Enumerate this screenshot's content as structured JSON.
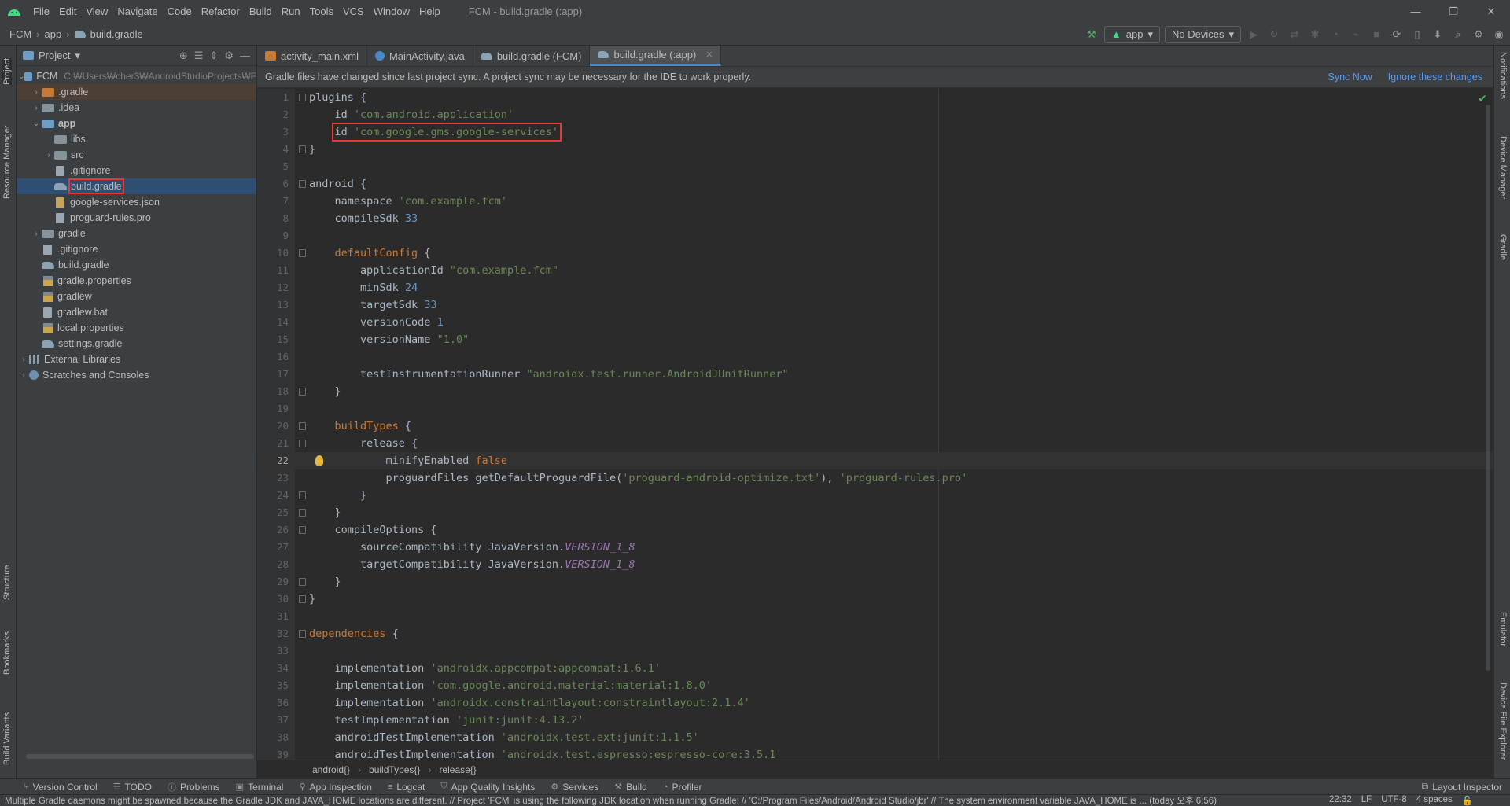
{
  "menubar": {
    "items": [
      "File",
      "Edit",
      "View",
      "Navigate",
      "Code",
      "Refactor",
      "Build",
      "Run",
      "Tools",
      "VCS",
      "Window",
      "Help"
    ],
    "window_title": "FCM - build.gradle (:app)",
    "controls": [
      "—",
      "❐",
      "✕"
    ]
  },
  "navbar": {
    "crumbs": [
      "FCM",
      "app",
      "build.gradle"
    ],
    "run_config": "app",
    "device": "No Devices"
  },
  "left_stripe": {
    "project": "Project",
    "resource_manager": "Resource Manager",
    "structure": "Structure",
    "bookmarks": "Bookmarks",
    "build_variants": "Build Variants"
  },
  "right_stripe": {
    "notifications": "Notifications",
    "device_manager": "Device Manager",
    "gradle": "Gradle",
    "emulator": "Emulator",
    "device_file_explorer": "Device File Explorer"
  },
  "project_panel": {
    "title": "Project",
    "tree": [
      {
        "label": "FCM",
        "path": "C:₩Users₩cher3₩AndroidStudioProjects₩F"
      },
      {
        "label": ".gradle"
      },
      {
        "label": ".idea"
      },
      {
        "label": "app"
      },
      {
        "label": "libs"
      },
      {
        "label": "src"
      },
      {
        "label": ".gitignore"
      },
      {
        "label": "build.gradle"
      },
      {
        "label": "google-services.json"
      },
      {
        "label": "proguard-rules.pro"
      },
      {
        "label": "gradle"
      },
      {
        "label": ".gitignore"
      },
      {
        "label": "build.gradle"
      },
      {
        "label": "gradle.properties"
      },
      {
        "label": "gradlew"
      },
      {
        "label": "gradlew.bat"
      },
      {
        "label": "local.properties"
      },
      {
        "label": "settings.gradle"
      },
      {
        "label": "External Libraries"
      },
      {
        "label": "Scratches and Consoles"
      }
    ]
  },
  "tabs": [
    "activity_main.xml",
    "MainActivity.java",
    "build.gradle (FCM)",
    "build.gradle (:app)"
  ],
  "notice": {
    "text": "Gradle files have changed since last project sync. A project sync may be necessary for the IDE to work properly.",
    "sync": "Sync Now",
    "ignore": "Ignore these changes"
  },
  "code": {
    "line_numbers": [
      "1",
      "2",
      "3",
      "4",
      "5",
      "6",
      "7",
      "8",
      "9",
      "10",
      "11",
      "12",
      "13",
      "14",
      "15",
      "16",
      "17",
      "18",
      "19",
      "20",
      "21",
      "22",
      "23",
      "24",
      "25",
      "26",
      "27",
      "28",
      "29",
      "30",
      "31",
      "32",
      "33",
      "34",
      "35",
      "36",
      "37",
      "38",
      "39"
    ],
    "t": {
      "plugins": "plugins {",
      "id": "id ",
      "app_plugin": "'com.android.application'",
      "gms_plugin": "'com.google.gms.google-services'",
      "close": "}",
      "android": "android {",
      "namespace": "namespace ",
      "namespace_val": "'com.example.fcm'",
      "compileSdk": "compileSdk ",
      "compileSdk_val": "33",
      "defaultConfig": "defaultConfig",
      "open": " {",
      "applicationId": "applicationId ",
      "applicationId_val": "\"com.example.fcm\"",
      "minSdk": "minSdk ",
      "minSdk_val": "24",
      "targetSdk": "targetSdk ",
      "targetSdk_val": "33",
      "versionCode": "versionCode ",
      "versionCode_val": "1",
      "versionName": "versionName ",
      "versionName_val": "\"1.0\"",
      "runner": "testInstrumentationRunner ",
      "runner_val": "\"androidx.test.runner.AndroidJUnitRunner\"",
      "buildTypes": "buildTypes",
      "release": "release {",
      "minify": "minifyEnabled ",
      "minify_val": "false",
      "proguard": "proguardFiles getDefaultProguardFile(",
      "proguard_val1": "'proguard-android-optimize.txt'",
      "proguard_comma": "), ",
      "proguard_val2": "'proguard-rules.pro'",
      "compileOptions": "compileOptions {",
      "source": "sourceCompatibility JavaVersion.",
      "target": "targetCompatibility JavaVersion.",
      "version18": "VERSION_1_8",
      "dependencies": "dependencies",
      "impl": "implementation ",
      "dep1": "'androidx.appcompat:appcompat:1.6.1'",
      "dep2": "'com.google.android.material:material:1.8.0'",
      "dep3": "'androidx.constraintlayout:constraintlayout:2.1.4'",
      "testImpl": "testImplementation ",
      "dep4": "'junit:junit:4.13.2'",
      "androidTestImpl": "androidTestImplementation ",
      "dep5": "'androidx.test.ext:junit:1.1.5'",
      "dep6": "'androidx.test.espresso:espresso-core:3.5.1'"
    }
  },
  "editor_crumbs": [
    "android{}",
    "buildTypes{}",
    "release{}"
  ],
  "toolwindows": [
    "Version Control",
    "TODO",
    "Problems",
    "Terminal",
    "App Inspection",
    "Logcat",
    "App Quality Insights",
    "Services",
    "Build",
    "Profiler"
  ],
  "layout_inspector": "Layout Inspector",
  "status": {
    "message": "Multiple Gradle daemons might be spawned because the Gradle JDK and JAVA_HOME locations are different. // Project 'FCM' is using the following JDK location when running Gradle: // 'C:/Program Files/Android/Android Studio/jbr' // The system environment variable JAVA_HOME is ... (today 오후 6:56)",
    "position": "22:32",
    "line_sep": "LF",
    "encoding": "UTF-8",
    "indent": "4 spaces"
  },
  "colors": {
    "accent": "#4a88c7",
    "highlight_box": "#e53935",
    "keyword": "#cc7832",
    "string": "#6a8759",
    "number": "#6897bb"
  }
}
